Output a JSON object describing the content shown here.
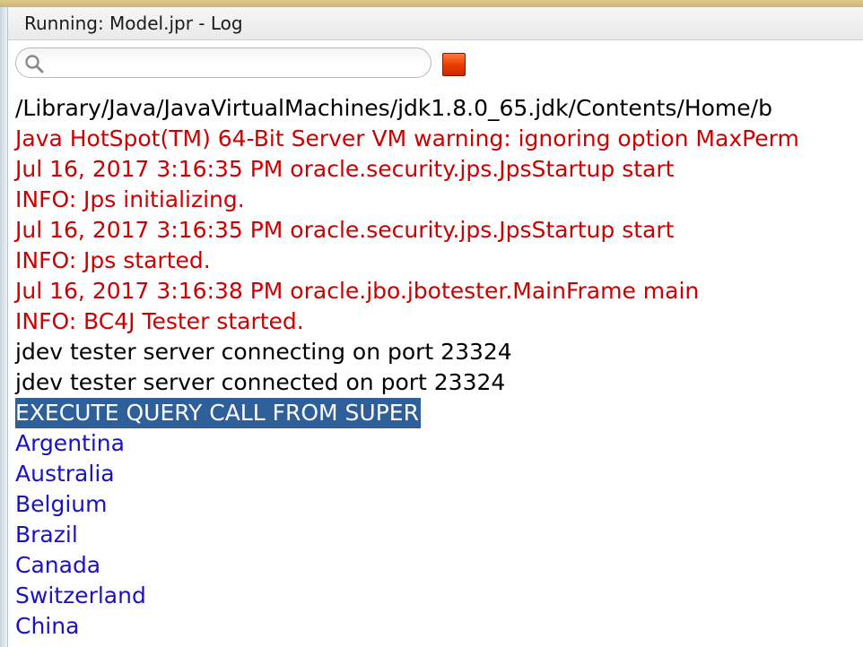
{
  "window": {
    "title": "Running: Model.jpr - Log"
  },
  "toolbar": {
    "search_placeholder": "",
    "search_value": "",
    "search_icon": "search-icon",
    "stop_icon": "stop-icon",
    "stop_color": "#e83a00"
  },
  "log": {
    "lines": [
      {
        "text": "/Library/Java/JavaVirtualMachines/jdk1.8.0_65.jdk/Contents/Home/b",
        "kind": "path"
      },
      {
        "text": "Java HotSpot(TM) 64-Bit Server VM warning: ignoring option MaxPerm",
        "kind": "err"
      },
      {
        "text": "Jul 16, 2017 3:16:35 PM oracle.security.jps.JpsStartup start",
        "kind": "err"
      },
      {
        "text": "INFO: Jps initializing.",
        "kind": "err"
      },
      {
        "text": "Jul 16, 2017 3:16:35 PM oracle.security.jps.JpsStartup start",
        "kind": "err"
      },
      {
        "text": "INFO: Jps started.",
        "kind": "err"
      },
      {
        "text": "Jul 16, 2017 3:16:38 PM oracle.jbo.jbotester.MainFrame main",
        "kind": "err"
      },
      {
        "text": "INFO: BC4J Tester started.",
        "kind": "err"
      },
      {
        "text": "jdev tester server connecting on port 23324",
        "kind": "out"
      },
      {
        "text": "jdev tester server connected on port 23324",
        "kind": "out"
      },
      {
        "text": "EXECUTE QUERY CALL FROM SUPER",
        "kind": "selected"
      },
      {
        "text": "Argentina",
        "kind": "data"
      },
      {
        "text": "Australia",
        "kind": "data"
      },
      {
        "text": "Belgium",
        "kind": "data"
      },
      {
        "text": "Brazil",
        "kind": "data"
      },
      {
        "text": "Canada",
        "kind": "data"
      },
      {
        "text": "Switzerland",
        "kind": "data"
      },
      {
        "text": "China",
        "kind": "data"
      }
    ]
  },
  "colors": {
    "error_text": "#cc0000",
    "data_text": "#1a12c2",
    "selection_bg": "#2f5f99"
  }
}
